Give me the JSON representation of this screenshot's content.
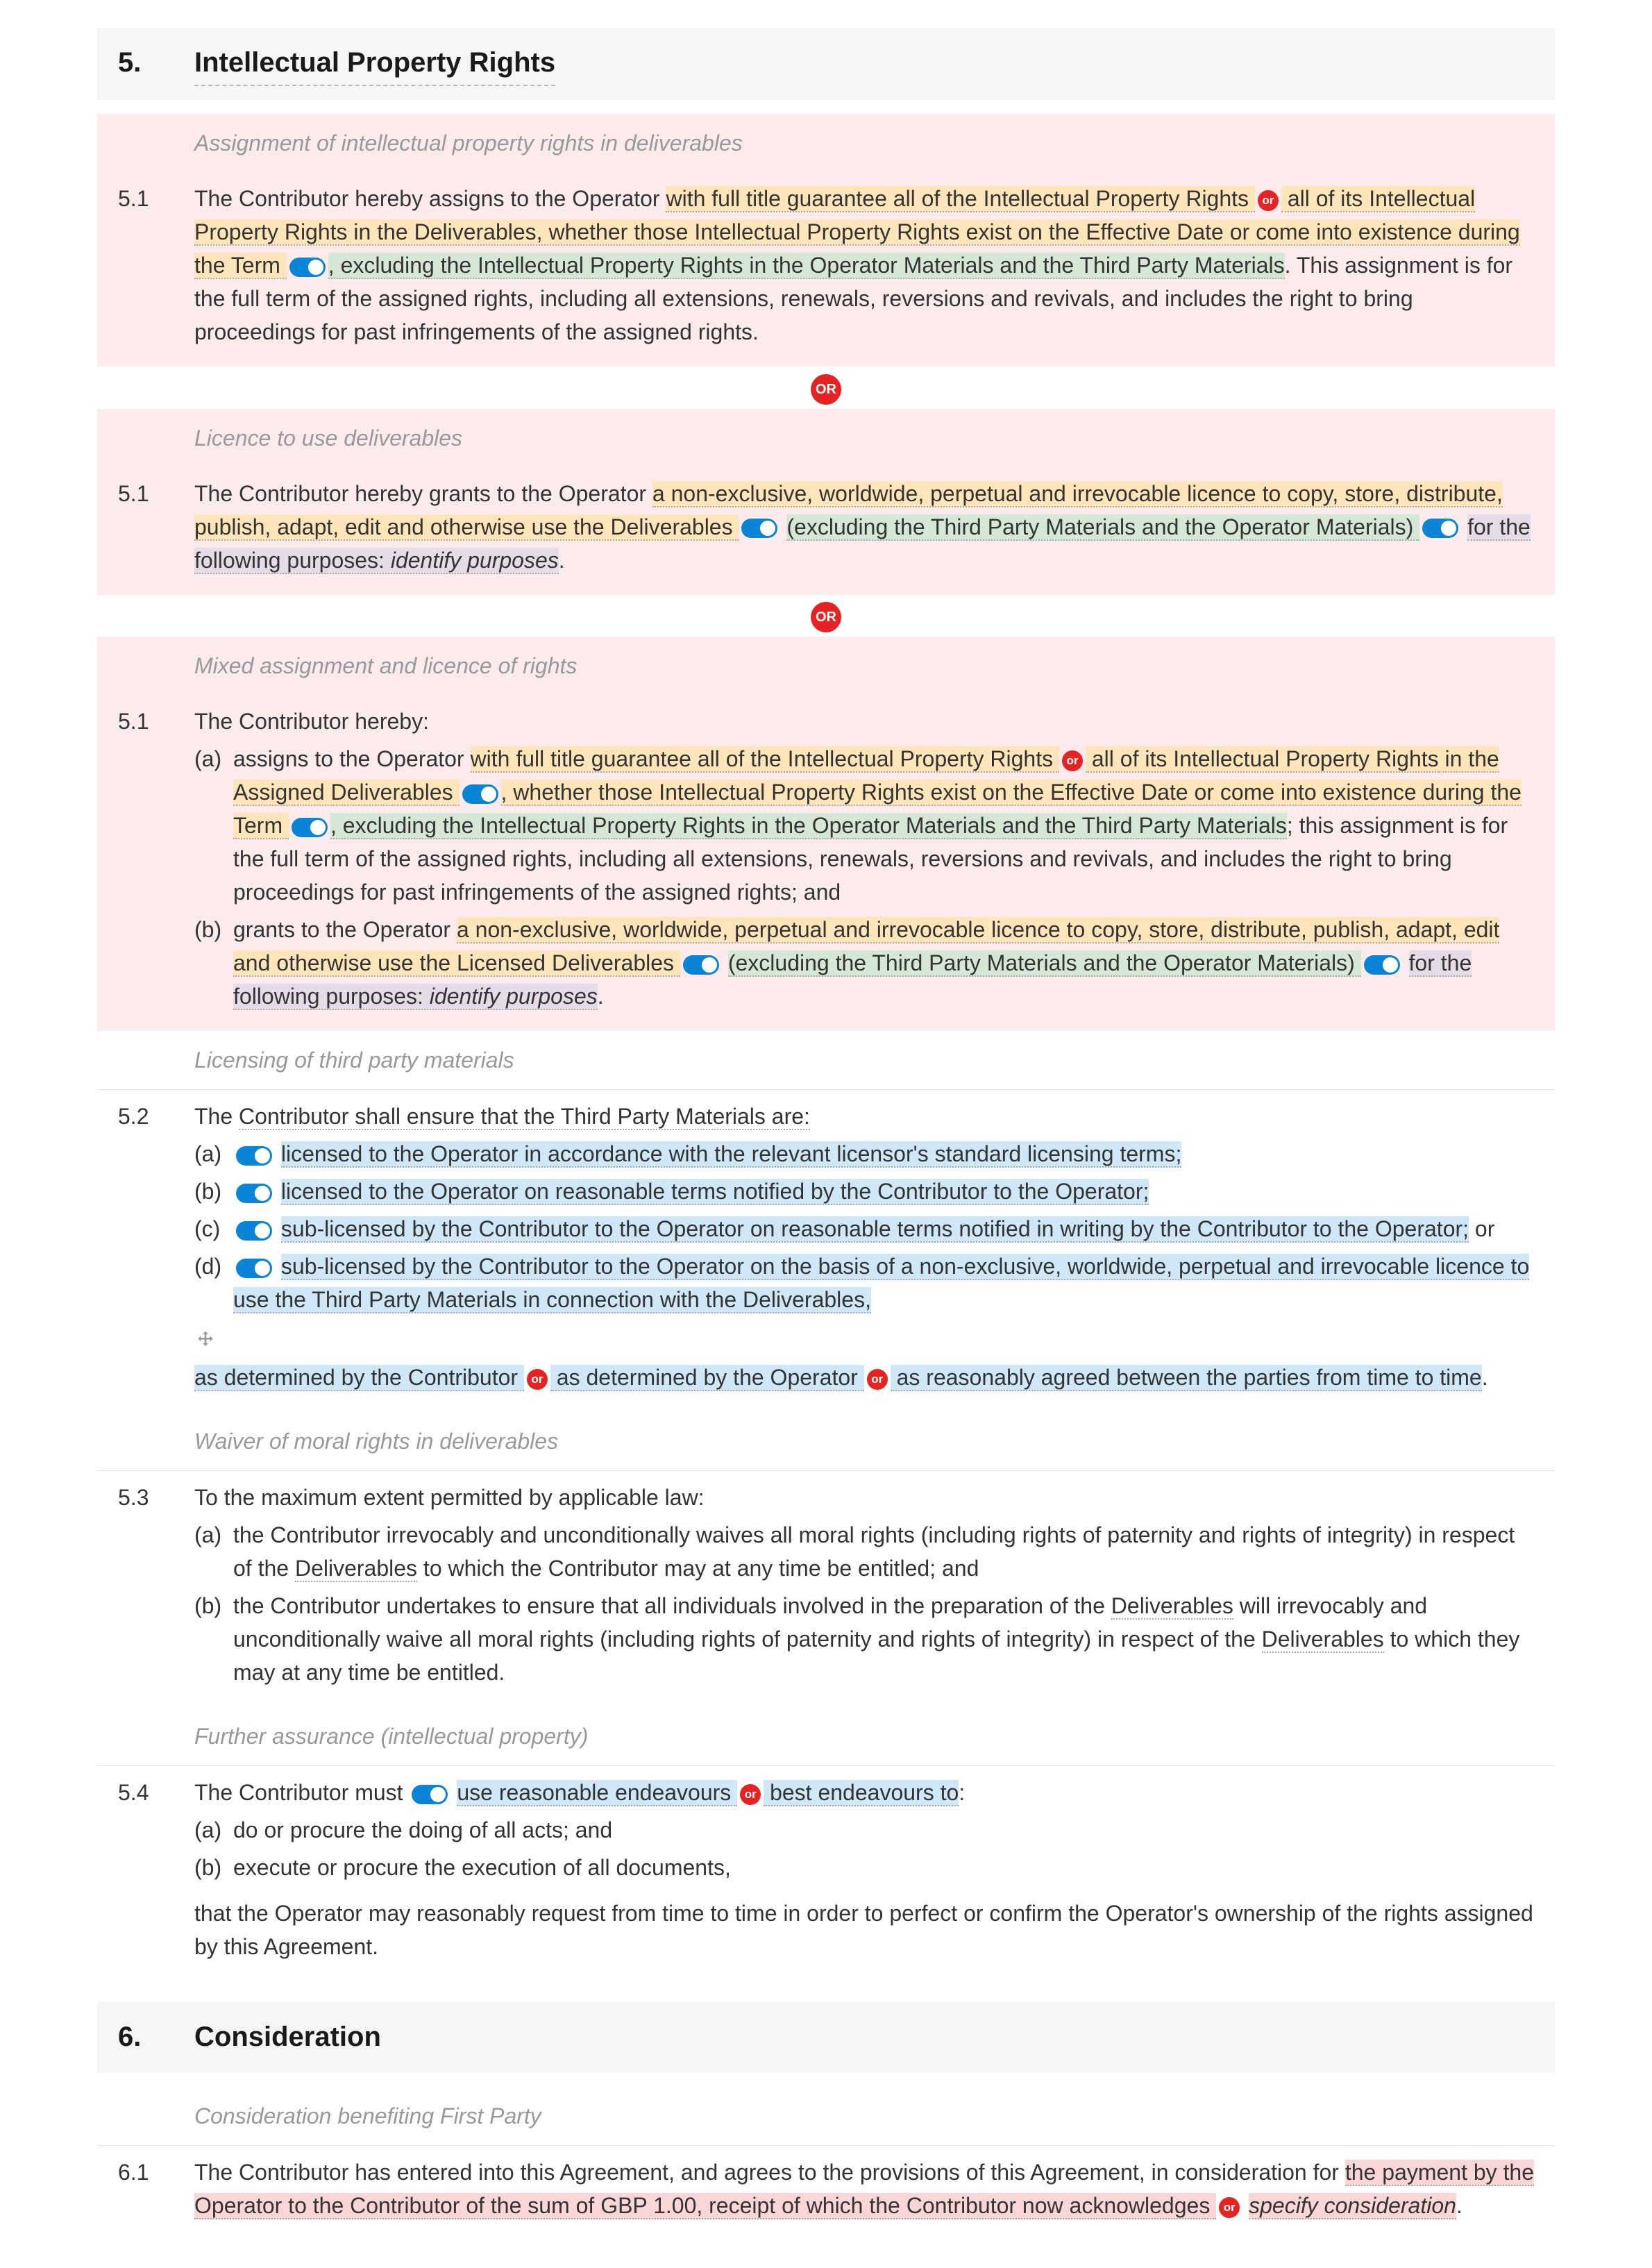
{
  "section5": {
    "num": "5.",
    "title": "Intellectual Property Rights",
    "c51a_title": "Assignment of intellectual property rights in deliverables",
    "c51a_num": "5.1",
    "c51a_t1": "The Contributor hereby assigns to the Operator ",
    "c51a_o1": "with full title guarantee all of the Intellectual Property Rights ",
    "c51a_or1": "or",
    "c51a_o2": " all of its Intellectual Property Rights",
    "c51a_t2": " in the Deliverables, whether those Intellectual Property Rights exist on the Effective Date or come into existence during the Term ",
    "c51a_g1": ", excluding the Intellectual Property Rights in the Operator Materials and the Third Party Materials",
    "c51a_t3": ". This assignment is for the full term of the assigned rights, including all extensions, renewals, reversions and revivals, and includes the right to bring proceedings for past infringements of the assigned rights.",
    "or_sep": "OR",
    "c51b_title": "Licence to use deliverables",
    "c51b_num": "5.1",
    "c51b_t1": "The Contributor hereby grants to the Operator ",
    "c51b_o1": "a non-exclusive, worldwide, perpetual and irrevocable licence to copy, store, distribute, publish, adapt, edit and otherwise use the Deliverables ",
    "c51b_g1": "(excluding the Third Party Materials and the Operator Materials) ",
    "c51b_p1": "for the following purposes: ",
    "c51b_p2": "identify purposes",
    "c51b_dot": ".",
    "c51c_title": "Mixed assignment and licence of rights",
    "c51c_num": "5.1",
    "c51c_intro": "The Contributor hereby:",
    "c51c_a_label": "(a)",
    "c51c_a_t1": "assigns to the Operator ",
    "c51c_a_o1": "with full title guarantee all of the Intellectual Property Rights ",
    "c51c_a_or": "or",
    "c51c_a_o2": " all of its Intellectual Property Rights",
    "c51c_a_t2": " in the Assigned Deliverables ",
    "c51c_a_t3": ", whether those Intellectual Property Rights exist on the Effective Date or come into existence during the Term ",
    "c51c_a_g1": ", excluding the Intellectual Property Rights in the Operator Materials and the Third Party Materials",
    "c51c_a_t4": "; this assignment is for the full term of the assigned rights, including all extensions, renewals, reversions and revivals, and includes the right to bring proceedings for past infringements of the assigned rights; and",
    "c51c_b_label": "(b)",
    "c51c_b_t1": "grants to the Operator ",
    "c51c_b_o1": "a non-exclusive, worldwide, perpetual and irrevocable licence to copy, store, distribute, publish, adapt, edit and otherwise use the Licensed Deliverables ",
    "c51c_b_g1": "(excluding the Third Party Materials and the Operator Materials) ",
    "c51c_b_p1": "for the following purposes: ",
    "c51c_b_p2": "identify purposes",
    "c51c_b_dot": ".",
    "c52_title": "Licensing of third party materials",
    "c52_num": "5.2",
    "c52_intro_t1": "The ",
    "c52_intro_t2": "Contributor shall ensure that the Third Party Materials are:",
    "c52_a_label": "(a)",
    "c52_a": "licensed to the Operator in accordance with the relevant licensor's standard licensing terms;",
    "c52_b_label": "(b)",
    "c52_b": "licensed to the Operator on reasonable terms notified by the Contributor to the Operator;",
    "c52_c_label": "(c)",
    "c52_c": "sub-licensed by the Contributor to the Operator on reasonable terms notified in writing by the Contributor to the Operator;",
    "c52_c_or": " or",
    "c52_d_label": "(d)",
    "c52_d": "sub-licensed by the Contributor to the Operator on the basis of a non-exclusive, worldwide, perpetual and irrevocable licence to use the Third Party Materials in connection with the Deliverables,",
    "c52_tail_1": "as determined by the Contributor ",
    "c52_tail_or1": "or",
    "c52_tail_2": " as determined by the Operator ",
    "c52_tail_or2": "or",
    "c52_tail_3": " as reasonably agreed between the parties from time to time",
    "c52_tail_dot": ".",
    "c53_title": "Waiver of moral rights in deliverables",
    "c53_num": "5.3",
    "c53_intro": "To the maximum extent permitted by applicable law:",
    "c53_a_label": "(a)",
    "c53_a_t1": "the Contributor irrevocably and unconditionally waives all moral rights (including rights of paternity and rights of integrity) in respect of the ",
    "c53_a_d": "Deliverables",
    "c53_a_t2": " to which the Contributor may at any time be entitled; and",
    "c53_b_label": "(b)",
    "c53_b_t1": "the Contributor undertakes to ensure that all individuals involved in the preparation of the ",
    "c53_b_d1": "Deliverables",
    "c53_b_t2": " will irrevocably and unconditionally waive all moral rights (including rights of paternity and rights of integrity) in respect of the ",
    "c53_b_d2": "Deliverables",
    "c53_b_t3": " to which they may at any time be entitled.",
    "c54_title": "Further assurance (intellectual property)",
    "c54_num": "5.4",
    "c54_t1": "The Contributor must ",
    "c54_t2": "use ",
    "c54_o1": "reasonable endeavours ",
    "c54_or": "or",
    "c54_o2": " best endeavours to",
    "c54_colon": ":",
    "c54_a_label": "(a)",
    "c54_a": "do or procure the doing of all acts; and",
    "c54_b_label": "(b)",
    "c54_b": "execute or procure the execution of all documents,",
    "c54_tail": "that the Operator may reasonably request from time to time in order to perfect or confirm the Operator's ownership of the rights assigned by this Agreement."
  },
  "section6": {
    "num": "6.",
    "title": "Consideration",
    "c61_title": "Consideration benefiting First Party",
    "c61_num": "6.1",
    "c61_t1": "The Contributor has entered into this Agreement, and agrees to the provisions of this Agreement, in consideration for ",
    "c61_o1": "the payment by the Operator to the Contributor of the sum of GBP 1.00, receipt of which the Contributor now acknowledges ",
    "c61_or": "or",
    "c61_o2": "specify consideration",
    "c61_dot": "."
  }
}
